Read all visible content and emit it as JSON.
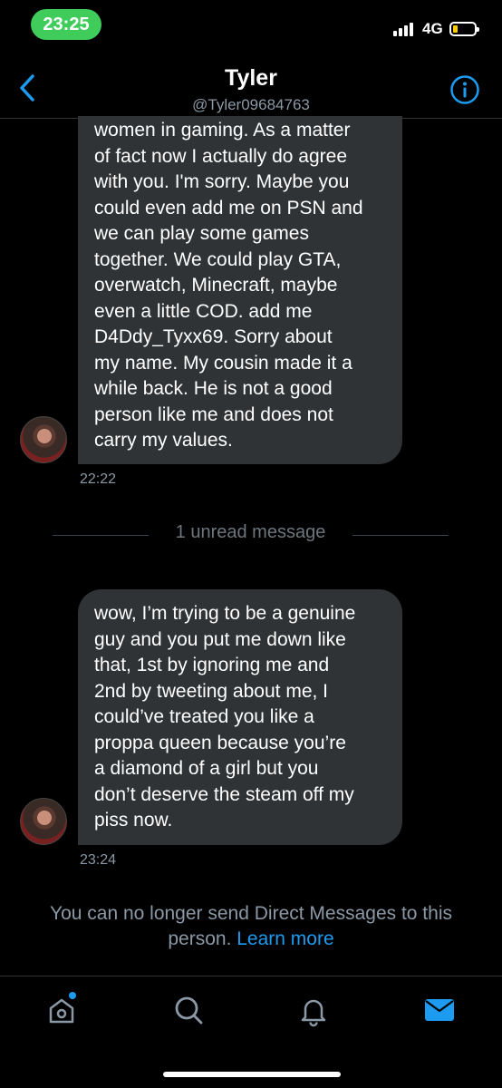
{
  "status_bar": {
    "time": "23:25",
    "network": "4G",
    "battery_level": 0.15,
    "signal_bars": 4
  },
  "header": {
    "name": "Tyler",
    "handle": "@Tyler09684763",
    "back_icon": "chevron-left-icon",
    "info_icon": "info-circle-icon",
    "accent_color": "#1d9bf0"
  },
  "messages": [
    {
      "text": "women in gaming. As a matter\nof fact now I actually do agree\nwith you. I'm sorry. Maybe you\ncould even add me on PSN and\nwe can play some games\ntogether. We could play GTA,\noverwatch, Minecraft, maybe\neven a little COD. add me\nD4Ddy_Tyxx69. Sorry about\nmy name. My cousin made it a\nwhile back. He is not a good\nperson like me and does not\ncarry my values.",
      "time": "22:22"
    },
    {
      "text": "wow, I’m trying to be a genuine\nguy and you put me down like\nthat, 1st by ignoring me and\n2nd by tweeting about me, I\ncould’ve treated you like a\nproppa queen because you’re\na diamond of a girl but you\ndon’t deserve the steam off my\npiss now.",
      "time": "23:24"
    }
  ],
  "unread_divider": "1 unread message",
  "notice": {
    "text": "You can no longer send Direct Messages to this person.",
    "link": "Learn more"
  },
  "tab_bar": {
    "tabs": [
      {
        "icon": "home-icon",
        "notification_dot": true
      },
      {
        "icon": "search-icon"
      },
      {
        "icon": "bell-icon"
      },
      {
        "icon": "mail-icon",
        "active": true
      }
    ]
  }
}
